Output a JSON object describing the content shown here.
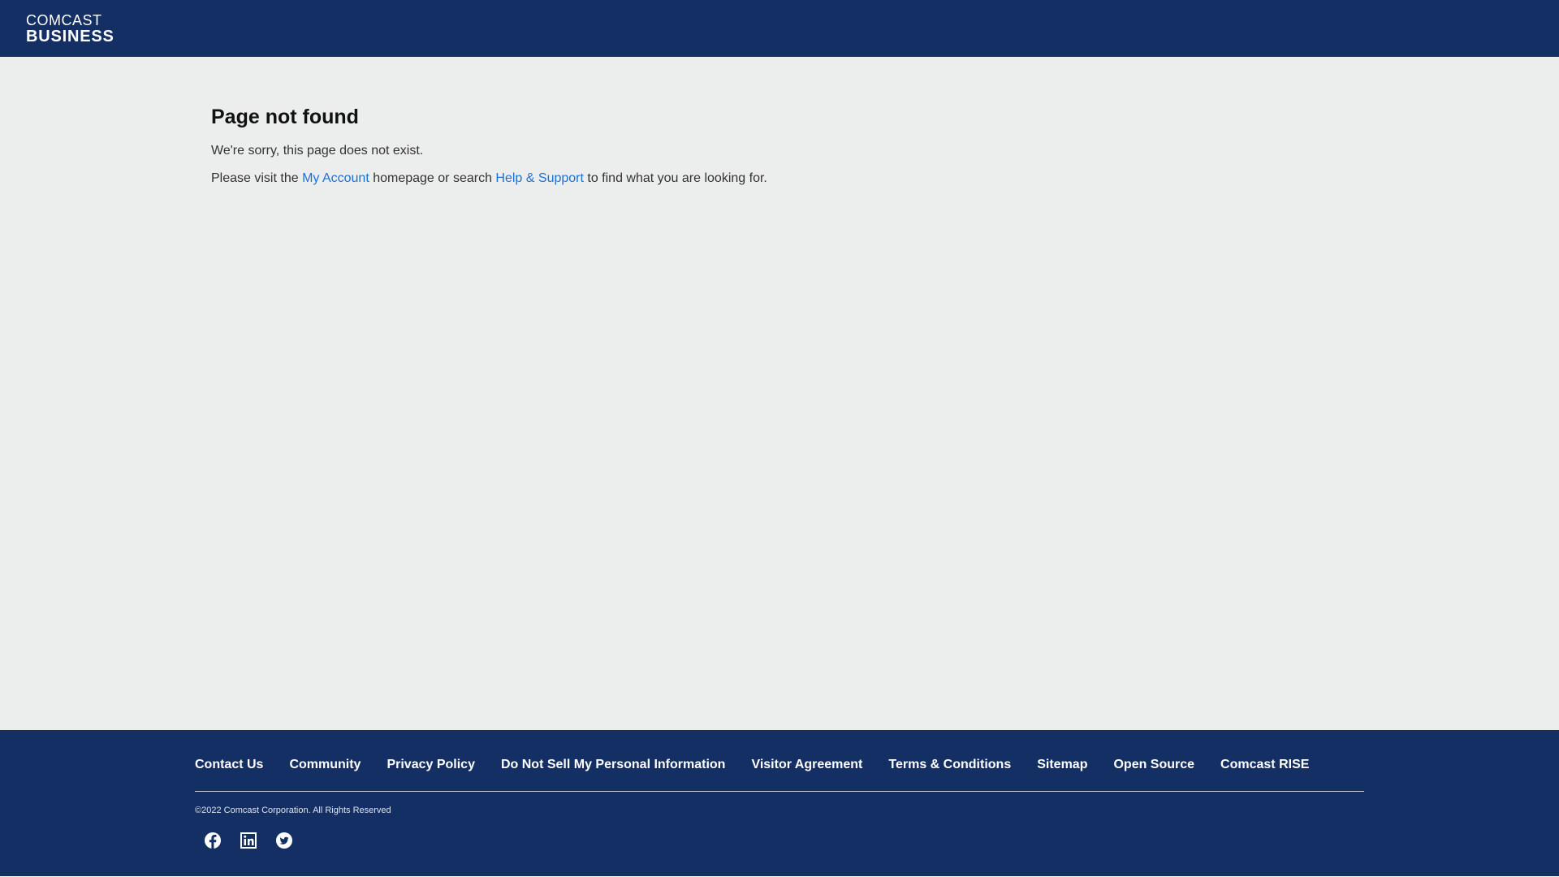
{
  "header": {
    "logo_top": "COMCAST",
    "logo_bottom": "BUSINESS"
  },
  "main": {
    "title": "Page not found",
    "message": "We're sorry, this page does not exist.",
    "help_prefix": "Please visit the ",
    "my_account_link": "My Account",
    "help_middle": " homepage or search ",
    "help_support_link": "Help & Support",
    "help_suffix": " to find what you are looking for."
  },
  "footer": {
    "links": [
      "Contact Us",
      "Community",
      "Privacy Policy",
      "Do Not Sell My Personal Information",
      "Visitor Agreement",
      "Terms & Conditions",
      "Sitemap",
      "Open Source",
      "Comcast RISE"
    ],
    "copyright": "©2022 Comcast Corporation. All Rights Reserved",
    "social_icons": [
      "facebook-icon",
      "linkedin-icon",
      "twitter-icon"
    ]
  },
  "colors": {
    "header_bg": "#142f63",
    "main_bg": "#eceeed",
    "link": "#1b71d8",
    "footer_bg": "#142f63"
  }
}
